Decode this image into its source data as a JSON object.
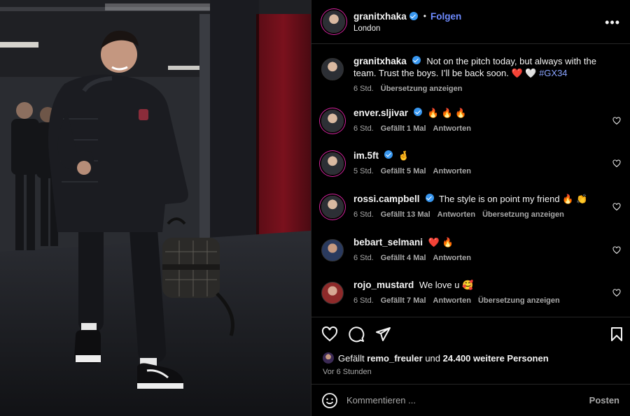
{
  "post": {
    "author": "granitxhaka",
    "follow_label": "Folgen",
    "location": "London",
    "more_icon": "more-horizontal-icon",
    "caption_text": "Not on the pitch today, but always with the team. Trust the boys. I’ll be back soon. ❤️ 🤍",
    "hashtag": "#GX34",
    "caption_time": "6 Std.",
    "caption_translate": "Übersetzung anzeigen"
  },
  "comments": [
    {
      "user": "enver.sljivar",
      "text": "🔥 🔥 🔥",
      "time": "6 Std.",
      "likes": "Gefällt 1 Mal",
      "reply": "Antworten",
      "translate": ""
    },
    {
      "user": "im.5ft",
      "text": "🤞",
      "time": "5 Std.",
      "likes": "Gefällt 5 Mal",
      "reply": "Antworten",
      "translate": ""
    },
    {
      "user": "rossi.campbell",
      "text": "The style is on point my friend 🔥 👏",
      "time": "6 Std.",
      "likes": "Gefällt 13 Mal",
      "reply": "Antworten",
      "translate": "Übersetzung anzeigen"
    },
    {
      "user": "bebart_selmani",
      "text": "❤️ 🔥",
      "time": "6 Std.",
      "likes": "Gefällt 4 Mal",
      "reply": "Antworten",
      "translate": ""
    },
    {
      "user": "rojo_mustard",
      "text": "We love u 🥰",
      "time": "6 Std.",
      "likes": "Gefällt 7 Mal",
      "reply": "Antworten",
      "translate": "Übersetzung anzeigen"
    }
  ],
  "actions": {
    "likes_prefix": "Gefällt",
    "likes_user": "remo_freuler",
    "likes_mid": "und",
    "likes_count": "24.400 weitere Personen",
    "timestamp": "Vor 6 Stunden"
  },
  "composer": {
    "placeholder": "Kommentieren ...",
    "post_label": "Posten"
  },
  "colors": {
    "background": "#000000",
    "link": "#6e8bff",
    "verified": "#3897f0",
    "secondary_text": "#a8a8a8"
  }
}
